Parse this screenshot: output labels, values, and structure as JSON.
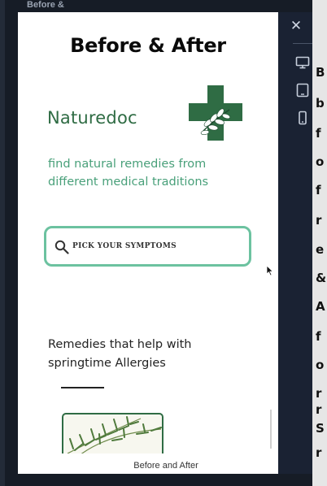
{
  "background": {
    "page_title": "Before &",
    "side_letters": [
      "B",
      "b",
      "f",
      "o",
      "f",
      "r",
      "e",
      "&",
      "A",
      "f",
      "o",
      "r",
      "r",
      "S",
      "r"
    ]
  },
  "modal": {
    "title": "Before & After",
    "footer_caption": "Before and After"
  },
  "preview": {
    "brand_name": "Naturedoc",
    "tagline": "find natural remedies from different medical traditions",
    "search": {
      "placeholder": "PICK YOUR SYMPTOMS",
      "value": ""
    },
    "section_heading": "Remedies that help with springtime Allergies"
  },
  "side_panel": {
    "close_icon": "close-icon",
    "devices": [
      "desktop-icon",
      "tablet-icon",
      "mobile-icon"
    ]
  },
  "colors": {
    "brand_green": "#2f6c44",
    "tagline_green": "#49a07a",
    "search_border": "#6cc2a0",
    "panel_bg": "#1a2233"
  }
}
